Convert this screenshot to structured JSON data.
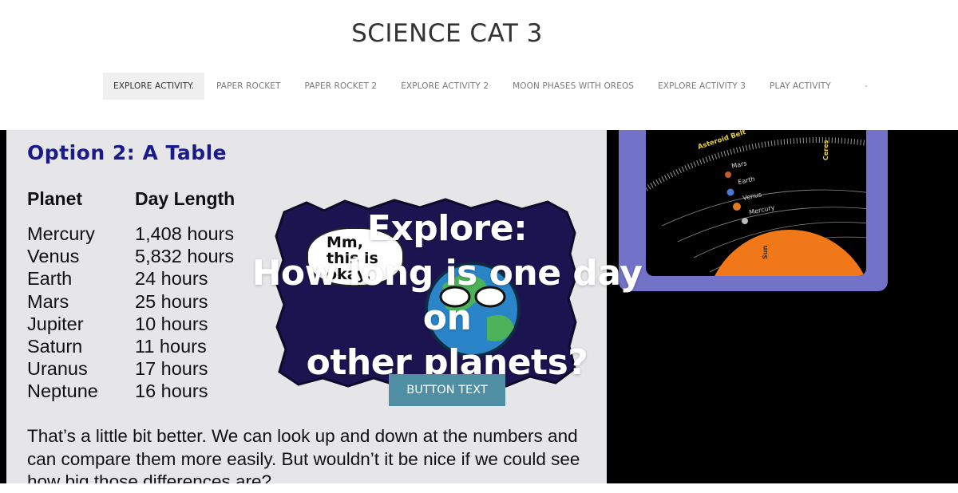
{
  "site": {
    "title": "SCIENCE CAT 3"
  },
  "nav": {
    "items": [
      {
        "label": "EXPLORE ACTIVITY."
      },
      {
        "label": "PAPER ROCKET"
      },
      {
        "label": "PAPER ROCKET 2"
      },
      {
        "label": "EXPLORE ACTIVITY 2"
      },
      {
        "label": "MOON PHASES WITH OREOS"
      },
      {
        "label": "EXPLORE ACTIVITY 3"
      },
      {
        "label": "PLAY ACTIVITY"
      }
    ]
  },
  "hero": {
    "heading_line1": "Explore:",
    "heading_line2": "How long is one day on",
    "heading_line3": "other planets?",
    "button_label": "BUTTON TEXT",
    "slide": {
      "option_title": "Option 2: A Table",
      "col_planet": "Planet",
      "col_day": "Day Length",
      "rows": [
        {
          "planet": "Mercury",
          "day": "1,408 hours"
        },
        {
          "planet": "Venus",
          "day": "5,832 hours"
        },
        {
          "planet": "Earth",
          "day": "24 hours"
        },
        {
          "planet": "Mars",
          "day": "25 hours"
        },
        {
          "planet": "Jupiter",
          "day": "10 hours"
        },
        {
          "planet": "Saturn",
          "day": "11 hours"
        },
        {
          "planet": "Uranus",
          "day": "17 hours"
        },
        {
          "planet": "Neptune",
          "day": "16 hours"
        }
      ],
      "paragraph": "That’s a little bit better. We can look up and down at the numbers and can compare them more easily. But wouldn’t it be nice if we could see how big those differences are?",
      "bubble_text": "Mm, this is okay.",
      "diagram_labels": {
        "asteroid": "Asteroid Belt",
        "ceres": "Ceres",
        "mars": "Mars",
        "earth": "Earth",
        "venus": "Venus",
        "mercury": "Mercury",
        "sun": "Sun"
      }
    }
  },
  "colors": {
    "button": "#4f8ea3",
    "option_title": "#1a1a8c",
    "diagram_frame": "#7272c8",
    "cartoon_bg": "#1c1450",
    "sun": "#f07818"
  }
}
